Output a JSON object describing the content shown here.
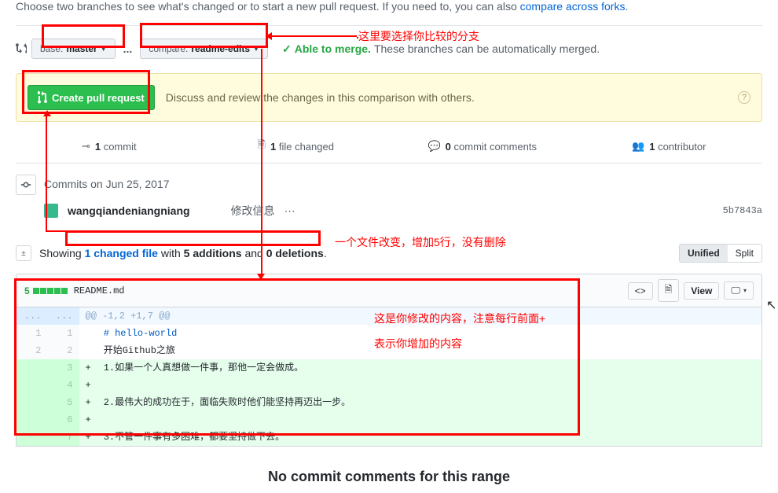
{
  "intro": {
    "text": "Choose two branches to see what's changed or to start a new pull request. If you need to, you can also ",
    "link": "compare across forks",
    "period": "."
  },
  "compare": {
    "base_label": "base:",
    "base_value": "master",
    "compare_label": "compare:",
    "compare_value": "readme-edits",
    "able": "Able to merge.",
    "merge_text": "These branches can be automatically merged."
  },
  "banner": {
    "button": "Create pull request",
    "text": "Discuss and review the changes in this comparison with others."
  },
  "stats": {
    "commits_n": "1",
    "commits": "commit",
    "files_n": "1",
    "files": "file changed",
    "comments_n": "0",
    "comments": "commit comments",
    "contrib_n": "1",
    "contrib": "contributor"
  },
  "timeline": {
    "date": "Commits on Jun 25, 2017"
  },
  "commit": {
    "author": "wangqiandeniangniang",
    "msg": "修改信息",
    "hash": "5b7843a"
  },
  "showing": {
    "prefix": "Showing",
    "link": "1 changed file",
    "mid": "with",
    "adds": "5 additions",
    "and": "and",
    "dels": "0 deletions",
    "period": "."
  },
  "toggle": {
    "unified": "Unified",
    "split": "Split"
  },
  "file": {
    "count": "5",
    "name": "README.md",
    "view": "View"
  },
  "diff": {
    "hunk": "@@ -1,2 +1,7 @@",
    "l1": "# hello-world",
    "l2": "开始Github之旅",
    "l3": "1.如果一个人真想做一件事，那他一定会做成。",
    "l4": "",
    "l5": "2.最伟大的成功在于，面临失败时他们能坚持再迈出一步。",
    "l6": "",
    "l7": "3.不管一件事有多困难，都要坚持做下去。"
  },
  "no_comments": "No commit comments for this range",
  "annotations": {
    "a1": "这里要选择你比较的分支",
    "a2": "一个文件改变，增加5行，没有删除",
    "a3a": "这是你修改的内容，注意每行前面+",
    "a3b": "表示你增加的内容"
  }
}
